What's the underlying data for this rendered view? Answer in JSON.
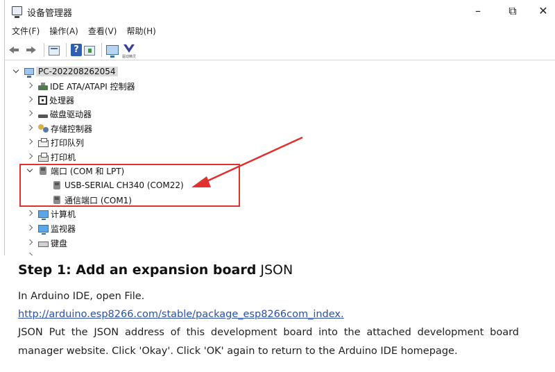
{
  "window": {
    "title": "设备管理器",
    "controls": {
      "minimize": "–",
      "maximize": "⧉",
      "close": "✕"
    }
  },
  "menu": [
    "文件(F)",
    "操作(A)",
    "查看(V)",
    "帮助(H)"
  ],
  "toolbar": {
    "icons": [
      "back-icon",
      "forward-icon",
      "properties-icon",
      "help-icon",
      "update-driver-icon",
      "scan-hardware-icon",
      "vendor-logo-icon"
    ],
    "vendor_label": "驱动精灵"
  },
  "tree": {
    "root": "PC-202208262054",
    "items": [
      {
        "label": "IDE ATA/ATAPI 控制器",
        "icon": "ide-controller-icon",
        "expanded": false
      },
      {
        "label": "处理器",
        "icon": "processor-icon",
        "expanded": false
      },
      {
        "label": "磁盘驱动器",
        "icon": "disk-drive-icon",
        "expanded": false
      },
      {
        "label": "存储控制器",
        "icon": "storage-controller-icon",
        "expanded": false
      },
      {
        "label": "打印队列",
        "icon": "print-queue-icon",
        "expanded": false
      },
      {
        "label": "打印机",
        "icon": "printer-icon",
        "expanded": false
      },
      {
        "label": "端口 (COM 和 LPT)",
        "icon": "port-icon",
        "expanded": true,
        "children": [
          "USB-SERIAL CH340 (COM22)",
          "通信端口 (COM1)"
        ]
      },
      {
        "label": "计算机",
        "icon": "computer-icon",
        "expanded": false
      },
      {
        "label": "监视器",
        "icon": "monitor-icon",
        "expanded": false
      },
      {
        "label": "键盘",
        "icon": "keyboard-icon",
        "expanded": false
      }
    ]
  },
  "annotation": {
    "box_color": "#e03030",
    "arrow_color": "#e03030"
  },
  "article": {
    "heading_bold": "Step 1: Add an expansion board",
    "heading_rest": " JSON",
    "line1": "In Arduino IDE, open File.",
    "link": "http://arduino.esp8266.com/stable/package_esp8266com_index.",
    "body": "JSON Put the JSON address of this development board into the attached development board manager website. Click 'Okay'. Click 'OK' again to return to the Arduino IDE homepage."
  },
  "colors": {
    "link": "#2a50a8",
    "highlight": "#e03030"
  }
}
